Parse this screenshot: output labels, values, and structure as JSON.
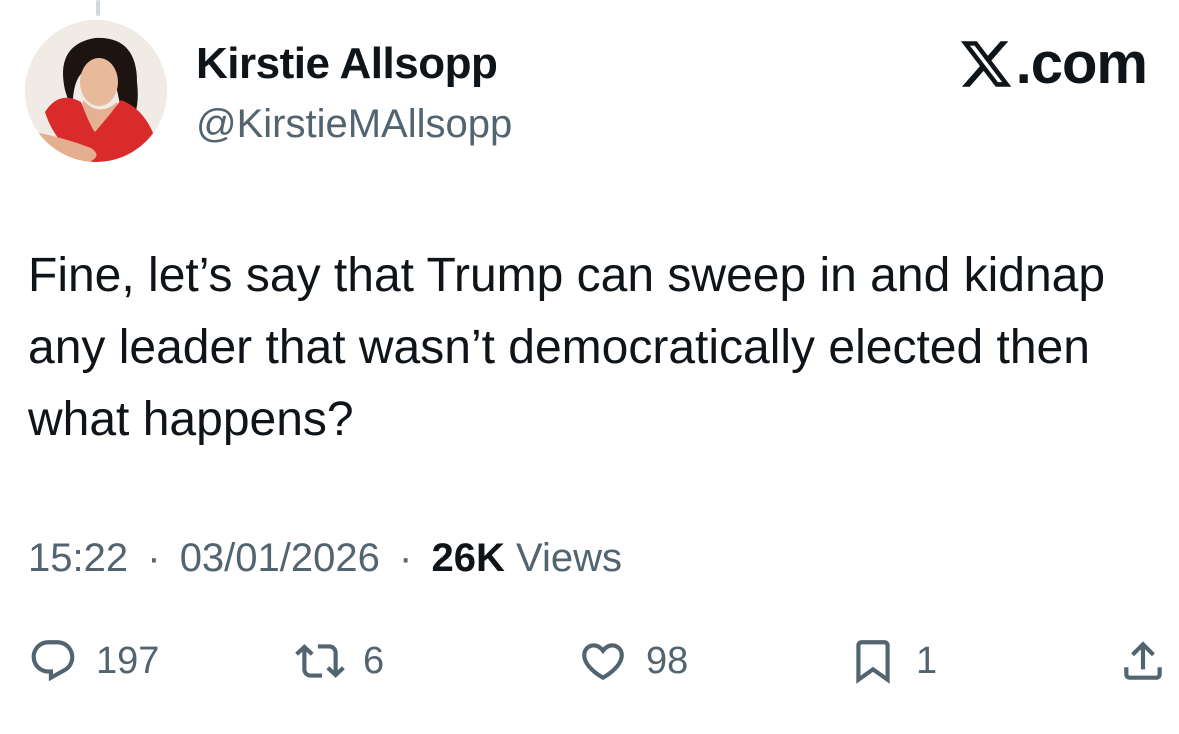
{
  "brand": {
    "label": ".com",
    "logo_icon": "x-logo-icon"
  },
  "author": {
    "display_name": "Kirstie Allsopp",
    "handle": "@KirstieMAllsopp"
  },
  "tweet": {
    "text": "Fine, let’s say that Trump can sweep in and kidnap any leader that wasn’t democratically elected then what happens?"
  },
  "meta": {
    "time": "15:22",
    "date": "03/01/2026",
    "separator": "·",
    "views_count": "26K",
    "views_label": "Views"
  },
  "actions": {
    "reply": {
      "icon": "reply-bubble-icon",
      "count": "197"
    },
    "retweet": {
      "icon": "retweet-icon",
      "count": "6"
    },
    "like": {
      "icon": "heart-icon",
      "count": "98"
    },
    "bookmark": {
      "icon": "bookmark-icon",
      "count": "1"
    },
    "share": {
      "icon": "share-upload-icon"
    }
  },
  "colors": {
    "text": "#0f1419",
    "secondary": "#536471",
    "avatar_dress": "#d92b2b"
  }
}
